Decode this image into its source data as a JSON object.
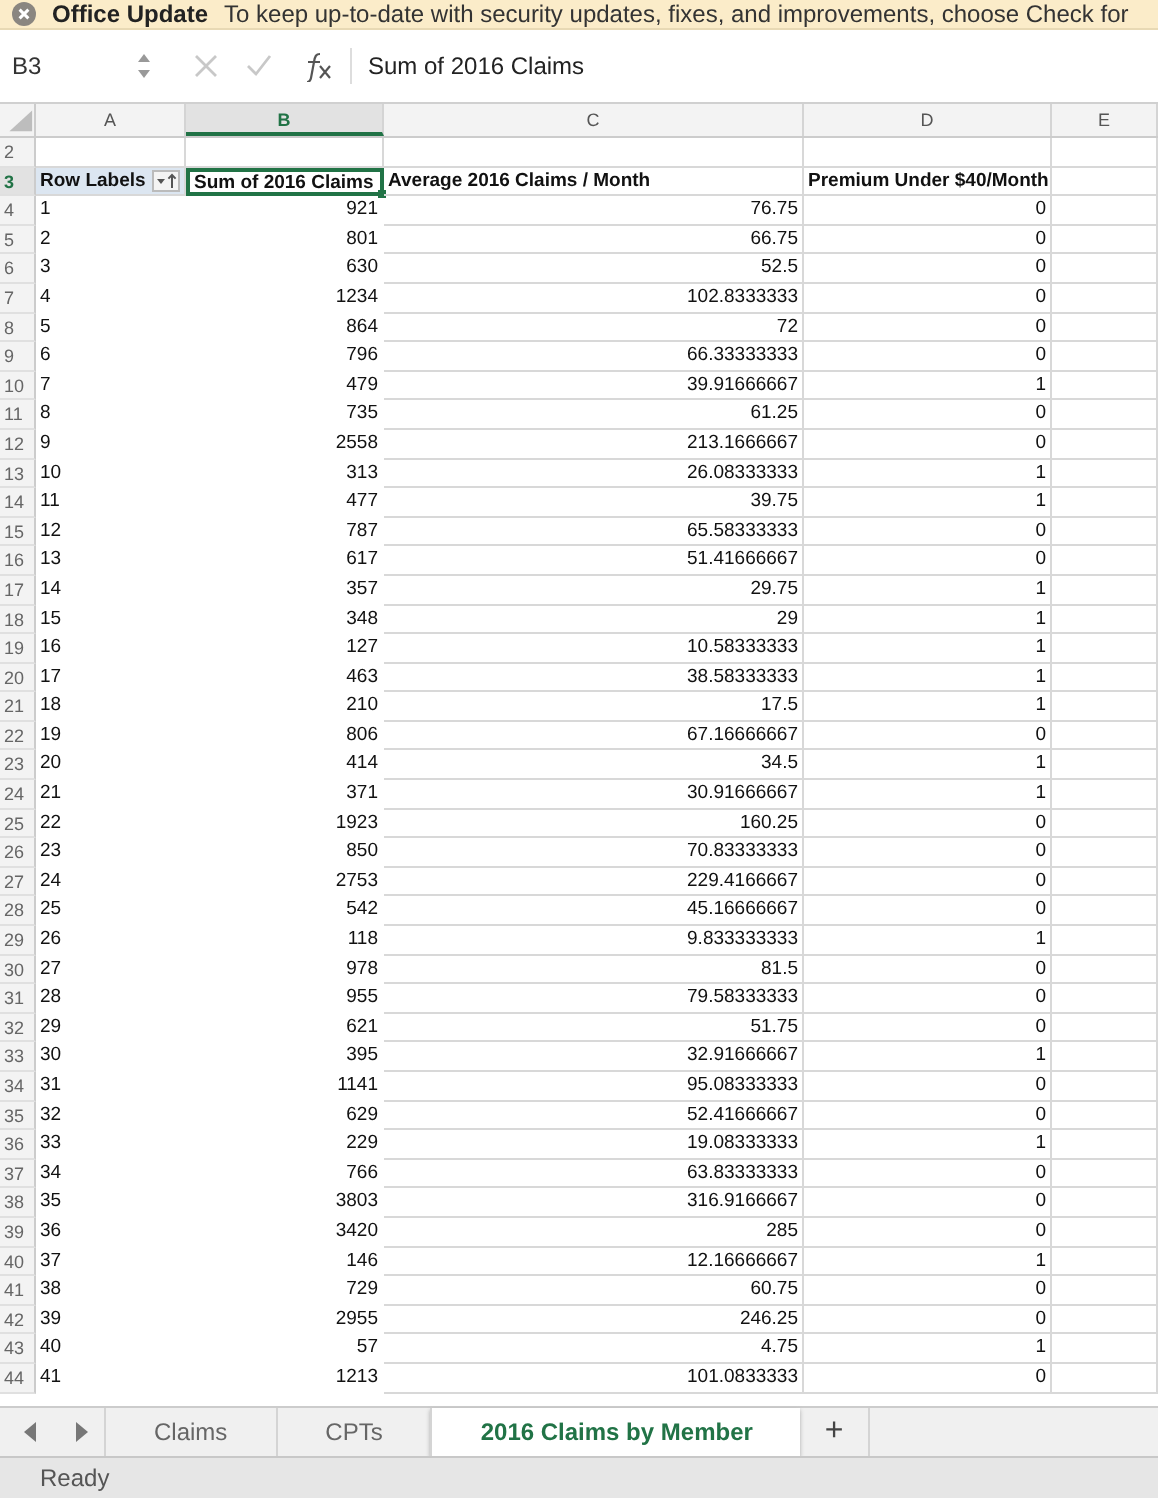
{
  "banner": {
    "title": "Office Update",
    "message": "To keep up-to-date with security updates, fixes, and improvements, choose Check for"
  },
  "formula_bar": {
    "cell_ref": "B3",
    "formula": "Sum of 2016 Claims"
  },
  "columns": [
    {
      "label": "A",
      "selected": false
    },
    {
      "label": "B",
      "selected": true
    },
    {
      "label": "C",
      "selected": false
    },
    {
      "label": "D",
      "selected": false
    },
    {
      "label": "E",
      "selected": false
    }
  ],
  "blank_row": {
    "number": "2",
    "selected": false
  },
  "header_row": {
    "number": "3",
    "selected": true,
    "cells": [
      {
        "text": "Row Labels",
        "selected": false
      },
      {
        "text": "Sum of 2016 Claims",
        "selected": true
      },
      {
        "text": "Average 2016 Claims / Month",
        "selected": false
      },
      {
        "text": "Premium Under $40/Month",
        "selected": false
      }
    ]
  },
  "rows": [
    {
      "number": "4",
      "selected": false,
      "cells": [
        "1",
        "921",
        "76.75",
        "0"
      ]
    },
    {
      "number": "5",
      "selected": false,
      "cells": [
        "2",
        "801",
        "66.75",
        "0"
      ]
    },
    {
      "number": "6",
      "selected": false,
      "cells": [
        "3",
        "630",
        "52.5",
        "0"
      ]
    },
    {
      "number": "7",
      "selected": false,
      "cells": [
        "4",
        "1234",
        "102.8333333",
        "0"
      ]
    },
    {
      "number": "8",
      "selected": false,
      "cells": [
        "5",
        "864",
        "72",
        "0"
      ]
    },
    {
      "number": "9",
      "selected": false,
      "cells": [
        "6",
        "796",
        "66.33333333",
        "0"
      ]
    },
    {
      "number": "10",
      "selected": false,
      "cells": [
        "7",
        "479",
        "39.91666667",
        "1"
      ]
    },
    {
      "number": "11",
      "selected": false,
      "cells": [
        "8",
        "735",
        "61.25",
        "0"
      ]
    },
    {
      "number": "12",
      "selected": false,
      "cells": [
        "9",
        "2558",
        "213.1666667",
        "0"
      ]
    },
    {
      "number": "13",
      "selected": false,
      "cells": [
        "10",
        "313",
        "26.08333333",
        "1"
      ]
    },
    {
      "number": "14",
      "selected": false,
      "cells": [
        "11",
        "477",
        "39.75",
        "1"
      ]
    },
    {
      "number": "15",
      "selected": false,
      "cells": [
        "12",
        "787",
        "65.58333333",
        "0"
      ]
    },
    {
      "number": "16",
      "selected": false,
      "cells": [
        "13",
        "617",
        "51.41666667",
        "0"
      ]
    },
    {
      "number": "17",
      "selected": false,
      "cells": [
        "14",
        "357",
        "29.75",
        "1"
      ]
    },
    {
      "number": "18",
      "selected": false,
      "cells": [
        "15",
        "348",
        "29",
        "1"
      ]
    },
    {
      "number": "19",
      "selected": false,
      "cells": [
        "16",
        "127",
        "10.58333333",
        "1"
      ]
    },
    {
      "number": "20",
      "selected": false,
      "cells": [
        "17",
        "463",
        "38.58333333",
        "1"
      ]
    },
    {
      "number": "21",
      "selected": false,
      "cells": [
        "18",
        "210",
        "17.5",
        "1"
      ]
    },
    {
      "number": "22",
      "selected": false,
      "cells": [
        "19",
        "806",
        "67.16666667",
        "0"
      ]
    },
    {
      "number": "23",
      "selected": false,
      "cells": [
        "20",
        "414",
        "34.5",
        "1"
      ]
    },
    {
      "number": "24",
      "selected": false,
      "cells": [
        "21",
        "371",
        "30.91666667",
        "1"
      ]
    },
    {
      "number": "25",
      "selected": false,
      "cells": [
        "22",
        "1923",
        "160.25",
        "0"
      ]
    },
    {
      "number": "26",
      "selected": false,
      "cells": [
        "23",
        "850",
        "70.83333333",
        "0"
      ]
    },
    {
      "number": "27",
      "selected": false,
      "cells": [
        "24",
        "2753",
        "229.4166667",
        "0"
      ]
    },
    {
      "number": "28",
      "selected": false,
      "cells": [
        "25",
        "542",
        "45.16666667",
        "0"
      ]
    },
    {
      "number": "29",
      "selected": false,
      "cells": [
        "26",
        "118",
        "9.833333333",
        "1"
      ]
    },
    {
      "number": "30",
      "selected": false,
      "cells": [
        "27",
        "978",
        "81.5",
        "0"
      ]
    },
    {
      "number": "31",
      "selected": false,
      "cells": [
        "28",
        "955",
        "79.58333333",
        "0"
      ]
    },
    {
      "number": "32",
      "selected": false,
      "cells": [
        "29",
        "621",
        "51.75",
        "0"
      ]
    },
    {
      "number": "33",
      "selected": false,
      "cells": [
        "30",
        "395",
        "32.91666667",
        "1"
      ]
    },
    {
      "number": "34",
      "selected": false,
      "cells": [
        "31",
        "1141",
        "95.08333333",
        "0"
      ]
    },
    {
      "number": "35",
      "selected": false,
      "cells": [
        "32",
        "629",
        "52.41666667",
        "0"
      ]
    },
    {
      "number": "36",
      "selected": false,
      "cells": [
        "33",
        "229",
        "19.08333333",
        "1"
      ]
    },
    {
      "number": "37",
      "selected": false,
      "cells": [
        "34",
        "766",
        "63.83333333",
        "0"
      ]
    },
    {
      "number": "38",
      "selected": false,
      "cells": [
        "35",
        "3803",
        "316.9166667",
        "0"
      ]
    },
    {
      "number": "39",
      "selected": false,
      "cells": [
        "36",
        "3420",
        "285",
        "0"
      ]
    },
    {
      "number": "40",
      "selected": false,
      "cells": [
        "37",
        "146",
        "12.16666667",
        "1"
      ]
    },
    {
      "number": "41",
      "selected": false,
      "cells": [
        "38",
        "729",
        "60.75",
        "0"
      ]
    },
    {
      "number": "42",
      "selected": false,
      "cells": [
        "39",
        "2955",
        "246.25",
        "0"
      ]
    },
    {
      "number": "43",
      "selected": false,
      "cells": [
        "40",
        "57",
        "4.75",
        "1"
      ]
    },
    {
      "number": "44",
      "selected": false,
      "cells": [
        "41",
        "1213",
        "101.0833333",
        "0"
      ]
    }
  ],
  "sheet_tabs": [
    {
      "label": "Claims",
      "selected": false
    },
    {
      "label": "CPTs",
      "selected": false
    },
    {
      "label": "2016 Claims by Member",
      "selected": true
    }
  ],
  "add_sheet": "+",
  "status_bar": "Ready"
}
